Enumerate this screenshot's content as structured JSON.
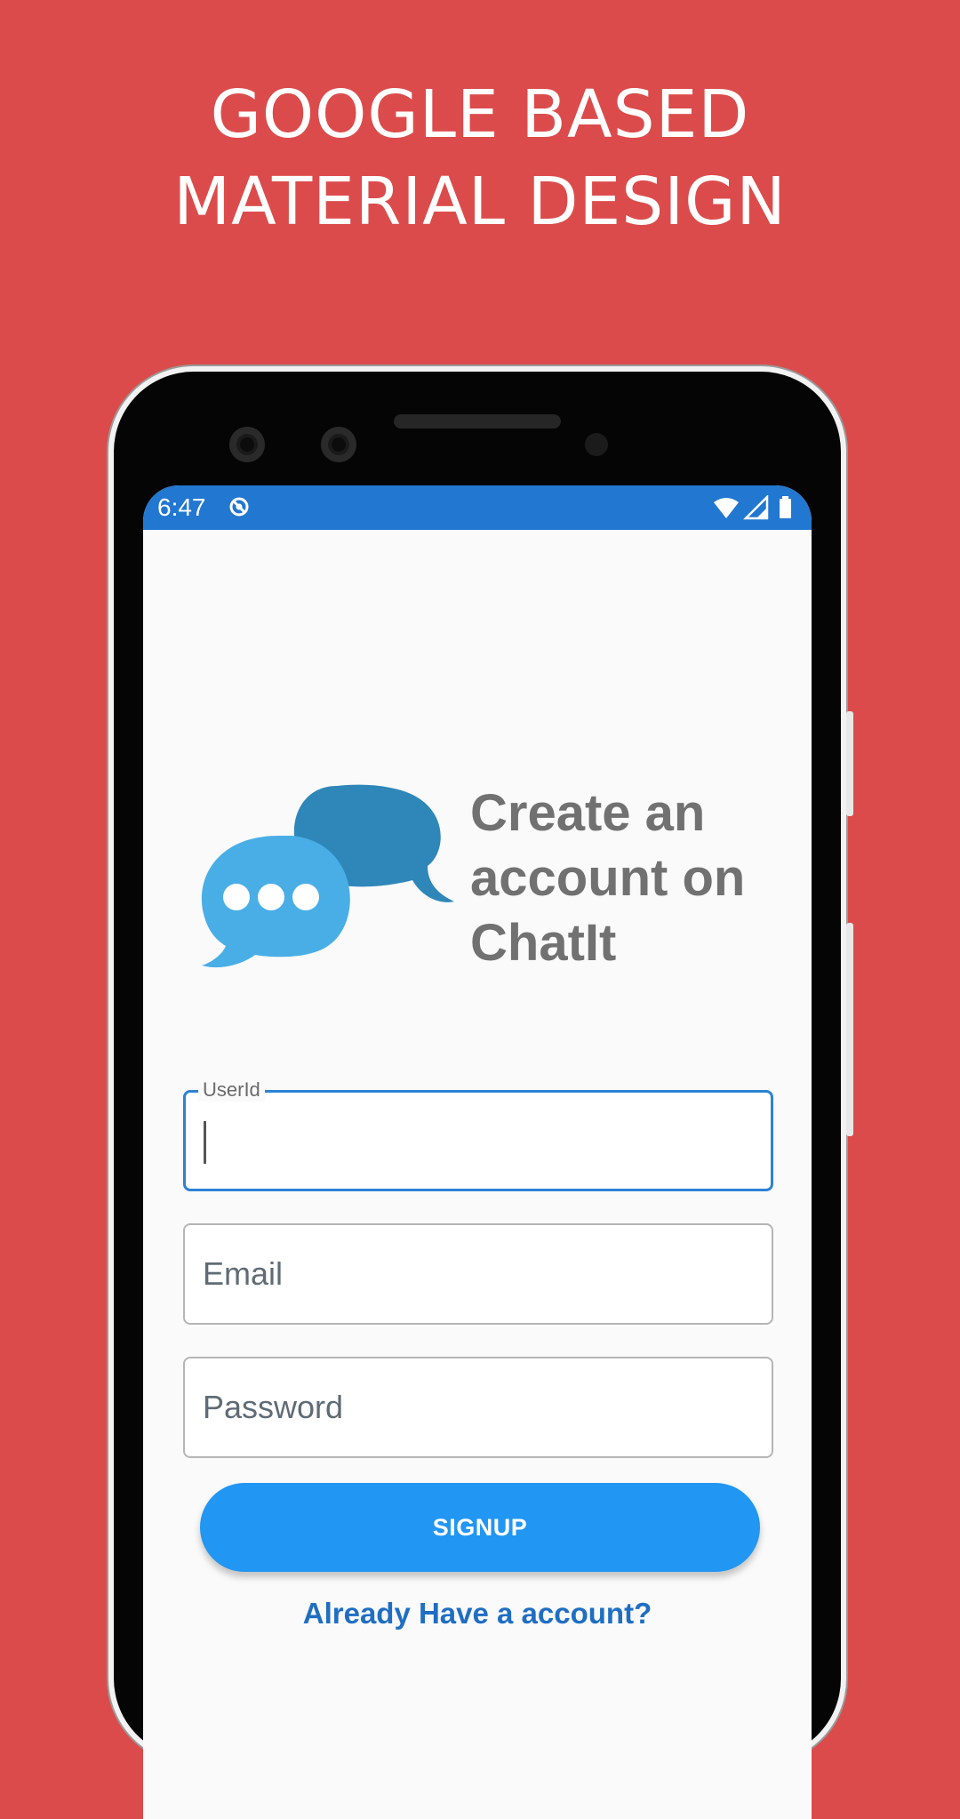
{
  "promo": {
    "headline_line1": "GOOGLE BASED",
    "headline_line2": "MATERIAL DESIGN",
    "background_color": "#DC4B4B"
  },
  "status_bar": {
    "time": "6:47",
    "color": "#2277D0",
    "icons": [
      "do-not-disturb-icon",
      "wifi-icon",
      "cellular-signal-icon",
      "battery-icon"
    ]
  },
  "app": {
    "title_line1": "Create an",
    "title_line2": "account on",
    "title_line3": "ChatIt",
    "logo_icon": "chat-bubbles-icon"
  },
  "form": {
    "userid_label": "UserId",
    "userid_value": "",
    "email_placeholder": "Email",
    "email_value": "",
    "password_placeholder": "Password",
    "password_value": "",
    "signup_label": "SIGNUP",
    "login_link": "Already Have a account?",
    "accent_color": "#2196F3"
  }
}
